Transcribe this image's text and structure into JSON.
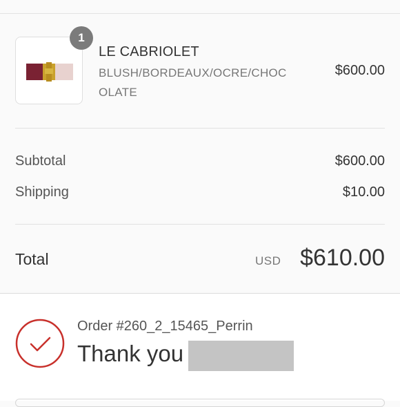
{
  "line_item": {
    "quantity": "1",
    "name": "LE CABRIOLET",
    "variant": "BLUSH/BORDEAUX/OCRE/CHOCOLATE",
    "price": "$600.00",
    "swatch_colors": [
      "#7a2233",
      "#c9a12c",
      "#e8d2cf"
    ]
  },
  "totals": {
    "subtotal_label": "Subtotal",
    "subtotal_value": "$600.00",
    "shipping_label": "Shipping",
    "shipping_value": "$10.00",
    "total_label": "Total",
    "currency": "USD",
    "total_value": "$610.00"
  },
  "confirmation": {
    "order_number": "Order #260_2_15465_Perrin",
    "thank_you": "Thank you",
    "accent_color": "#c8302b"
  }
}
